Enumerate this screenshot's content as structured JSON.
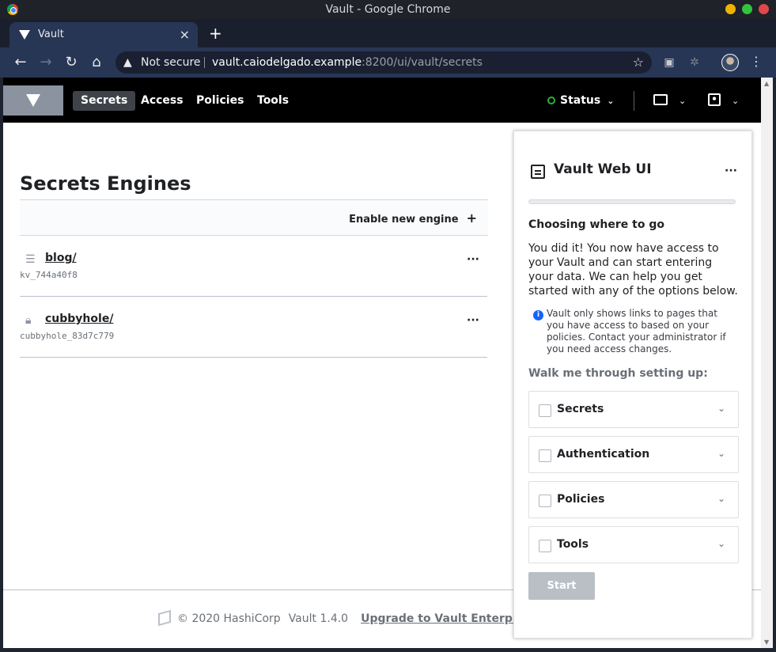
{
  "os": {
    "window_title": "Vault - Google Chrome",
    "controls": [
      "#f0b400",
      "#33c43d",
      "#e04848"
    ]
  },
  "browser": {
    "tab_title": "Vault",
    "tab_close": "×",
    "new_tab": "+",
    "security_label": "Not secure",
    "url_host": "vault.caiodelgado.example",
    "url_path": ":8200/ui/vault/secrets"
  },
  "nav": {
    "items": [
      "Secrets",
      "Access",
      "Policies",
      "Tools"
    ],
    "active": "Secrets",
    "status_label": "Status"
  },
  "main": {
    "title": "Secrets Engines",
    "enable_label": "Enable new engine",
    "engines": [
      {
        "name": "blog/",
        "id": "kv_744a40f8",
        "icon": "list-icon"
      },
      {
        "name": "cubbyhole/",
        "id": "cubbyhole_83d7c779",
        "icon": "lock-icon"
      }
    ]
  },
  "footer": {
    "copyright": "© 2020 HashiCorp",
    "version": "Vault 1.4.0",
    "upgrade": "Upgrade to Vault Enterprise"
  },
  "wizard": {
    "title": "Vault Web UI",
    "progress": 0,
    "heading": "Choosing where to go",
    "body": "You did it! You now have access to your Vault and can start entering your data. We can help you get started with any of the options below.",
    "note": "Vault only shows links to pages that you have access to based on your policies. Contact your administrator if you need access changes.",
    "sub": "Walk me through setting up:",
    "choices": [
      "Secrets",
      "Authentication",
      "Policies",
      "Tools"
    ],
    "start_label": "Start"
  },
  "colors": {
    "nav_bg": "#000000",
    "accent": "#1563ff",
    "status_ok": "#2eb039"
  }
}
